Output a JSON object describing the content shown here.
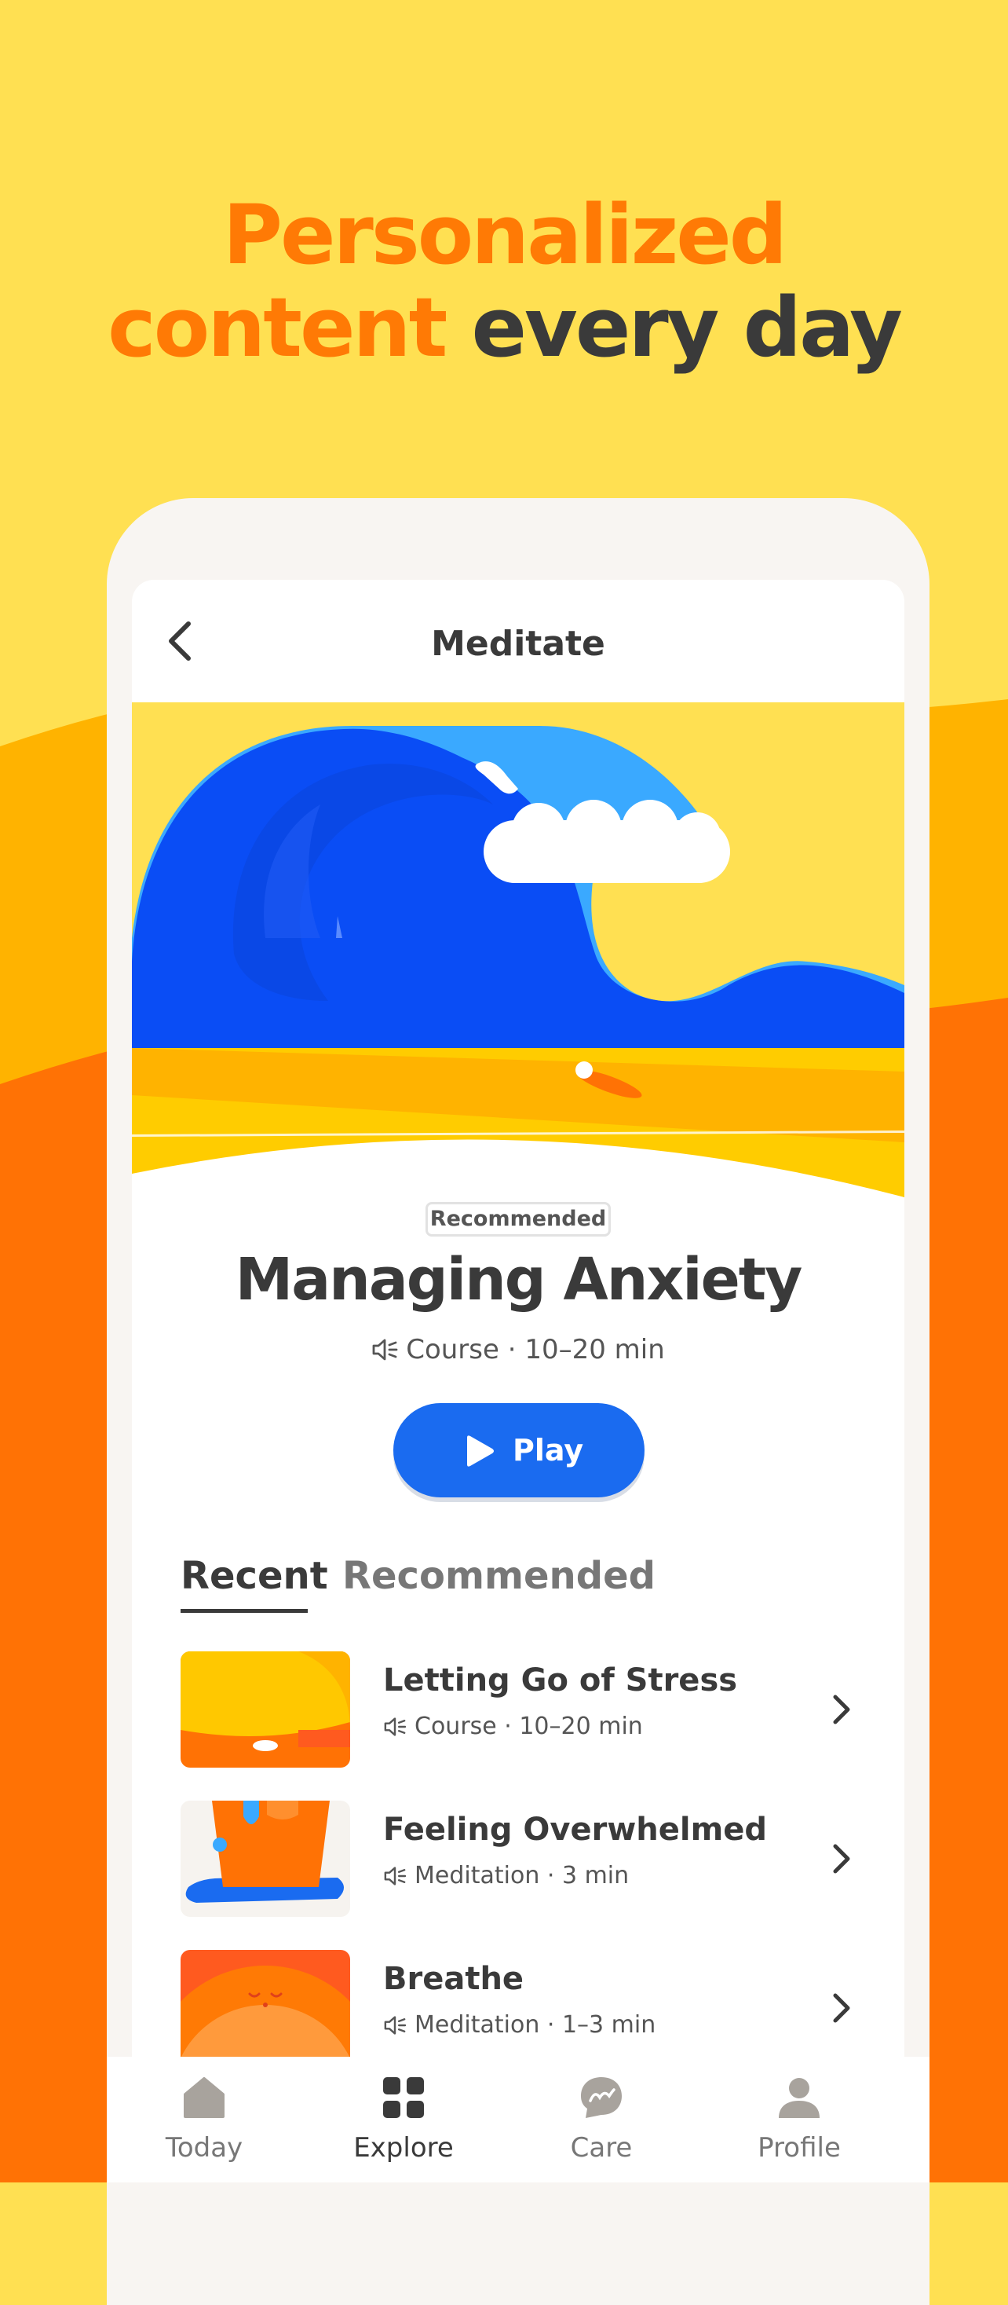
{
  "headline": {
    "line1": "Personalized",
    "line2_highlight": "content",
    "line2_rest": " every day"
  },
  "screen": {
    "title": "Meditate",
    "featured": {
      "badge": "Recommended",
      "title": "Managing Anxiety",
      "meta": "Course · 10–20 min",
      "play_label": "Play"
    },
    "tabs": [
      {
        "label": "Recent",
        "active": true
      },
      {
        "label": "Recommended",
        "active": false
      }
    ],
    "items": [
      {
        "title": "Letting Go of Stress",
        "meta": "Course · 10–20 min"
      },
      {
        "title": "Feeling Overwhelmed",
        "meta": "Meditation · 3 min"
      },
      {
        "title": "Breathe",
        "meta": "Meditation · 1–3 min"
      }
    ]
  },
  "bottom_nav": [
    {
      "label": "Today",
      "icon": "home-icon",
      "active": false
    },
    {
      "label": "Explore",
      "icon": "grid-icon",
      "active": true
    },
    {
      "label": "Care",
      "icon": "chat-bubble-icon",
      "active": false
    },
    {
      "label": "Profile",
      "icon": "person-icon",
      "active": false
    }
  ],
  "colors": {
    "background_yellow": "#ffe052",
    "band_orange_light": "#ffb300",
    "band_orange": "#ff7205",
    "accent_orange": "#ff7a05",
    "play_blue": "#1a6bf0",
    "text_dark": "#3a3a3a"
  }
}
